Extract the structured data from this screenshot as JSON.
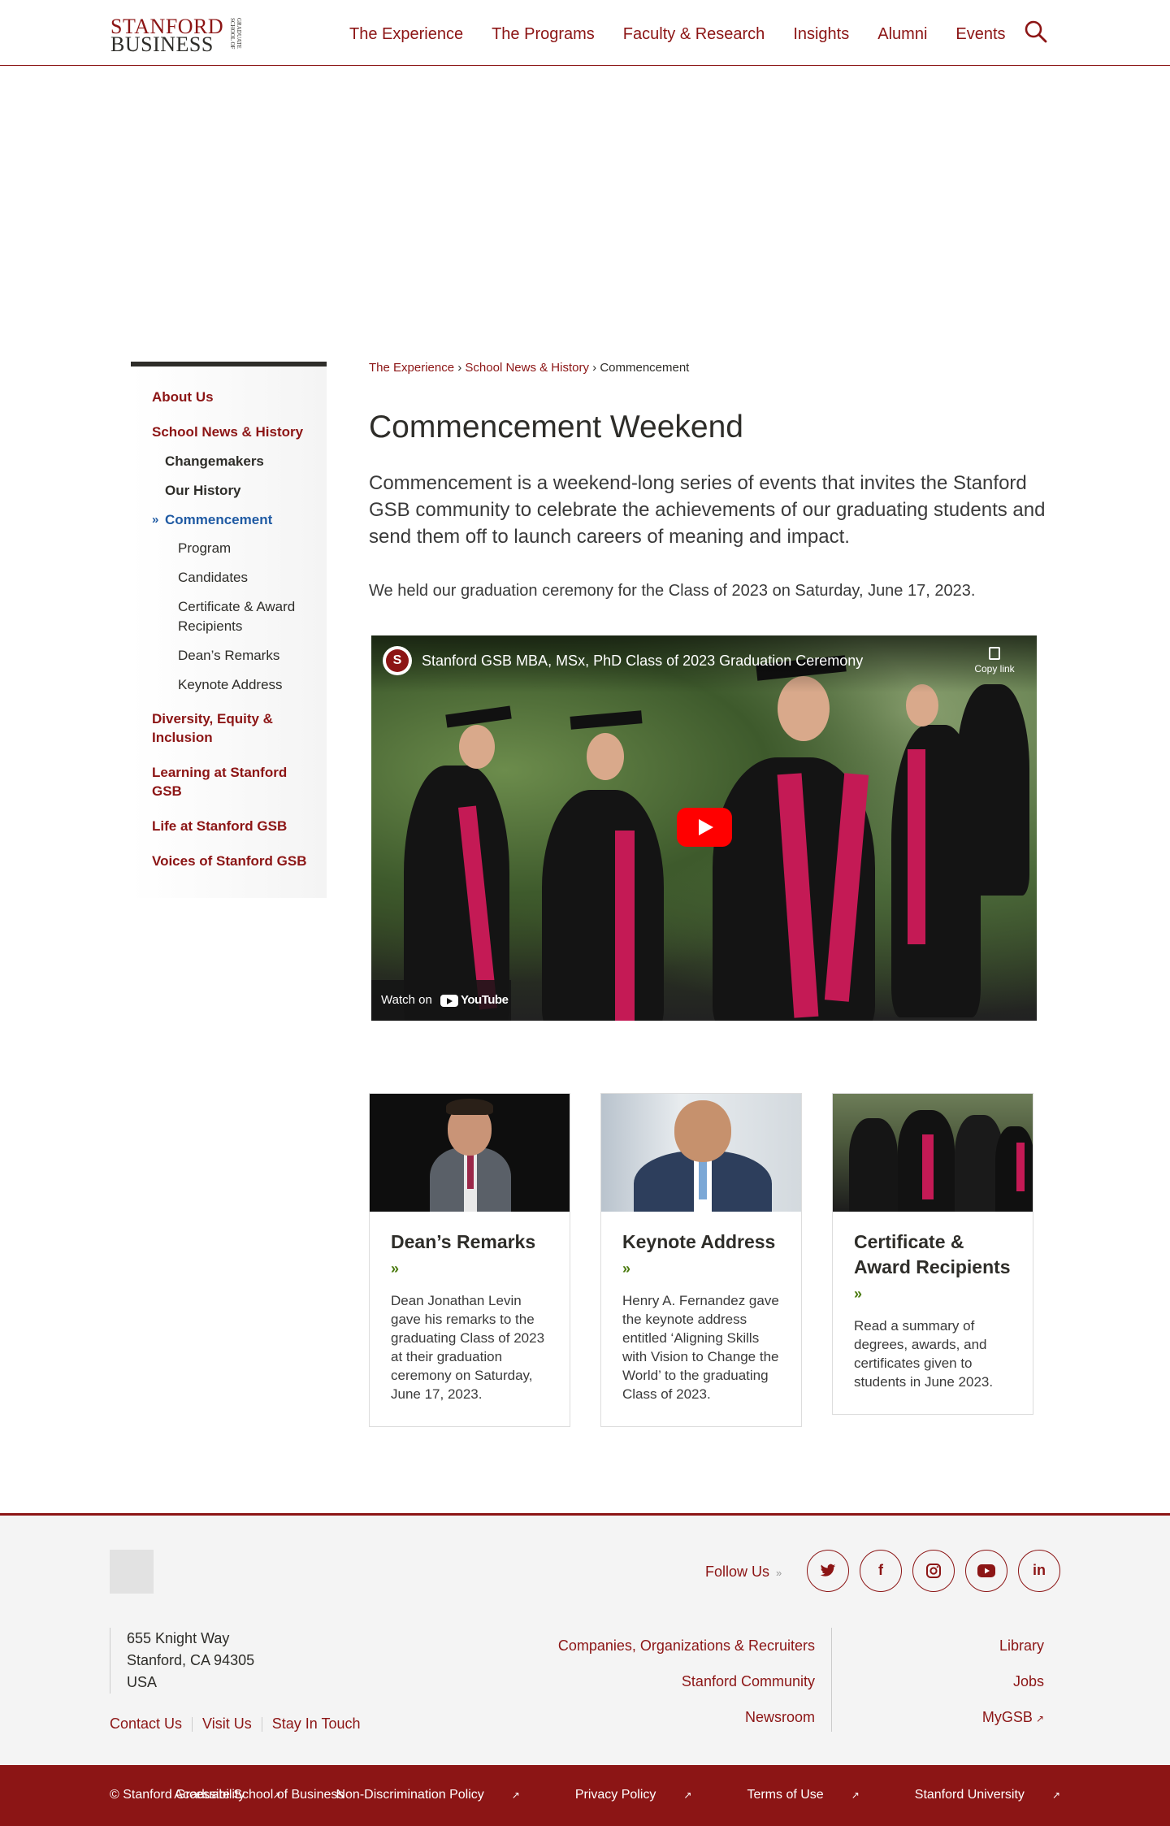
{
  "header": {
    "logo_line1": "STANFORD",
    "logo_line2": "BUSINESS",
    "logo_vertical": "GRADUATE SCHOOL OF",
    "nav": [
      "The Experience",
      "The Programs",
      "Faculty & Research",
      "Insights",
      "Alumni",
      "Events"
    ],
    "search_icon": "search-icon"
  },
  "breadcrumb": {
    "items": [
      "The Experience",
      "School News & History"
    ],
    "current": "Commencement",
    "sep": "›"
  },
  "sidebar": {
    "about": "About Us",
    "news": "School News & History",
    "changemakers": "Changemakers",
    "history": "Our History",
    "commencement": "Commencement",
    "program": "Program",
    "candidates": "Candidates",
    "certificate": "Certificate & Award Recipients",
    "deans": "Dean’s Remarks",
    "keynote": "Keynote Address",
    "diversity": "Diversity, Equity & Inclusion",
    "learning": "Learning at Stanford GSB",
    "life": "Life at Stanford GSB",
    "voices": "Voices of Stanford GSB"
  },
  "main": {
    "title": "Commencement Weekend",
    "intro": "Commencement is a weekend-long series of events that invites the Stanford GSB community to celebrate the achievements of our graduating students and send them off to launch careers of meaning and impact.",
    "body": "We held our graduation ceremony for the Class of 2023 on Saturday, June 17, 2023."
  },
  "video": {
    "title": "Stanford GSB MBA, MSx, PhD Class of 2023 Graduation Ceremony",
    "copy_link": "Copy link",
    "watch_on": "Watch on",
    "youtube": "YouTube",
    "channel_initial": "S"
  },
  "cards": [
    {
      "title": "Dean’s Remarks",
      "desc": "Dean Jonathan Levin gave his remarks to the graduating Class of 2023 at their graduation ceremony on Saturday, June 17, 2023."
    },
    {
      "title": "Keynote Address",
      "desc": "Henry A. Fernandez gave the keynote address entitled ‘Aligning Skills with Vision to Change the World’ to the graduating Class of 2023."
    },
    {
      "title": "Certificate & Award Recipients",
      "desc": "Read a summary of degrees, awards, and certificates given to students in June 2023."
    }
  ],
  "footer": {
    "follow": "Follow Us",
    "social": [
      "twitter-icon",
      "facebook-icon",
      "instagram-icon",
      "youtube-icon",
      "linkedin-icon"
    ],
    "address": [
      "655 Knight Way",
      "Stanford, CA 94305",
      "USA"
    ],
    "links1": [
      "Contact Us",
      "Visit Us",
      "Stay In Touch"
    ],
    "col2": [
      "Companies, Organizations & Recruiters",
      "Stanford Community",
      "Newsroom"
    ],
    "col3": [
      "Library",
      "Jobs",
      "MyGSB"
    ]
  },
  "bottom": {
    "copyright": "© Stanford Graduate School of Business",
    "links": [
      "Accessibility",
      "Non-Discrimination Policy",
      "Privacy Policy",
      "Terms of Use",
      "Stanford University"
    ]
  },
  "colors": {
    "brand": "#8c1515",
    "active": "#1f5aa3",
    "accent_arrow": "#4a7a0e"
  }
}
